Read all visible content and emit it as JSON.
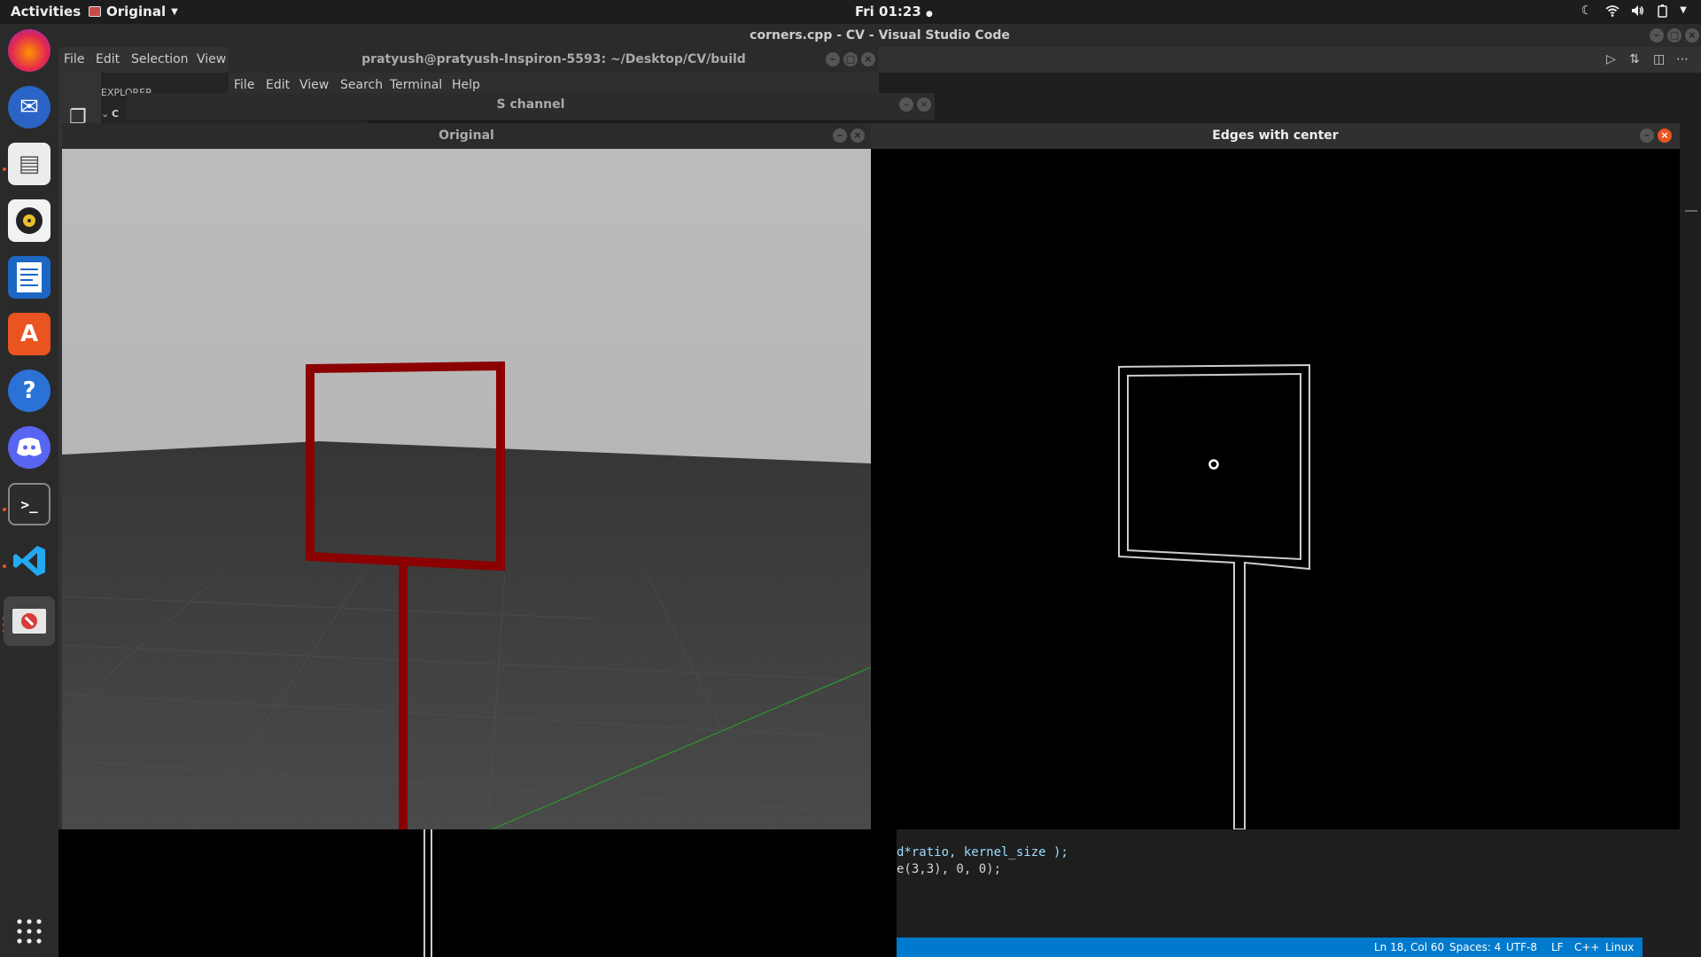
{
  "topbar": {
    "activities": "Activities",
    "app_menu": "Original",
    "clock": "Fri 01:23"
  },
  "dock": {
    "items": [
      "firefox",
      "thunderbird",
      "files",
      "rhythmbox",
      "libreoffice-writer",
      "software",
      "help",
      "discord",
      "terminal",
      "vscode",
      "opencv-window",
      "show-apps"
    ]
  },
  "vscode": {
    "title": "corners.cpp - CV - Visual Studio Code",
    "menu": [
      "File",
      "Edit",
      "Selection",
      "View"
    ],
    "explorer_label": "EXPLORER",
    "explorer_first_char": "C",
    "code_lines": [
      "d*ratio, kernel_size );",
      "e(3,3), 0, 0);"
    ],
    "status": {
      "position": "Ln 18, Col 60",
      "spaces": "Spaces: 4",
      "encoding": "UTF-8",
      "eol": "LF",
      "language": "C++",
      "os": "Linux"
    }
  },
  "terminal": {
    "title": "pratyush@pratyush-Inspiron-5593: ~/Desktop/CV/build",
    "menu": [
      "File",
      "Edit",
      "View",
      "Search",
      "Terminal",
      "Help"
    ]
  },
  "schannel": {
    "title": "S channel"
  },
  "original": {
    "title": "Original"
  },
  "edges": {
    "title": "Edges with center"
  }
}
